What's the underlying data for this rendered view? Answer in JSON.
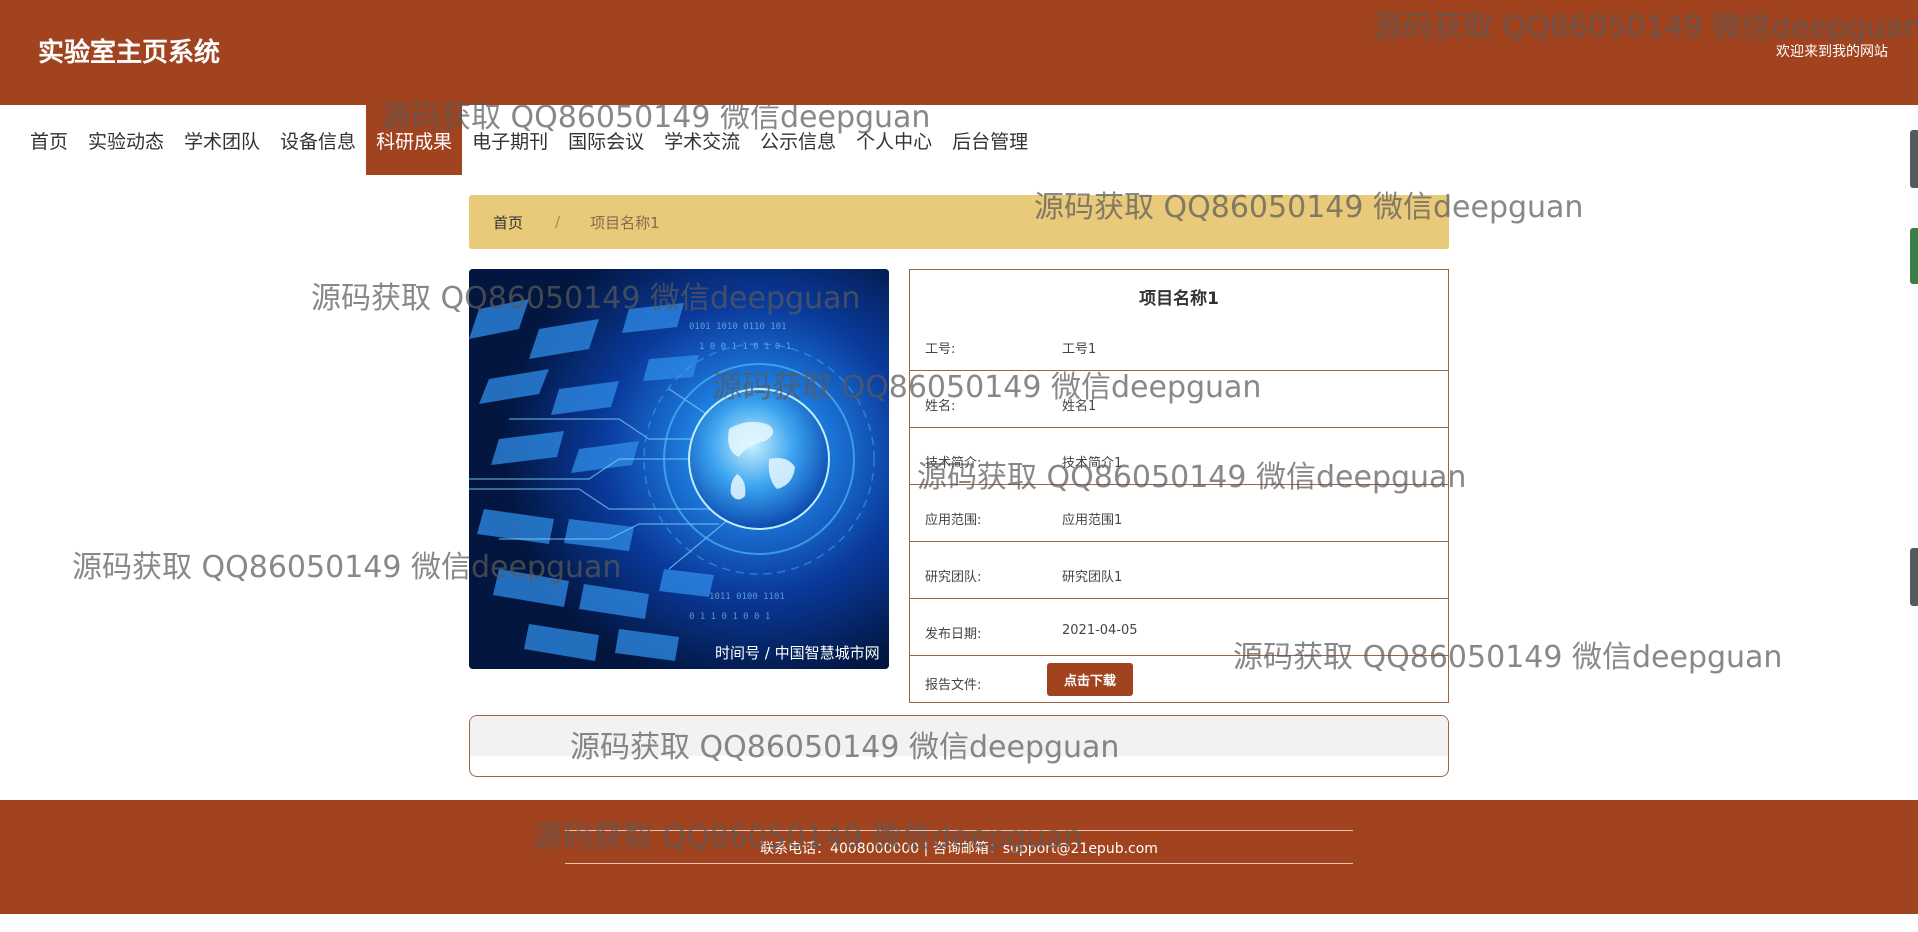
{
  "header": {
    "site_title": "实验室主页系统",
    "welcome": "欢迎来到我的网站"
  },
  "nav": {
    "items": [
      {
        "label": "首页"
      },
      {
        "label": "实验动态"
      },
      {
        "label": "学术团队"
      },
      {
        "label": "设备信息"
      },
      {
        "label": "科研成果",
        "active": true
      },
      {
        "label": "电子期刊"
      },
      {
        "label": "国际会议"
      },
      {
        "label": "学术交流"
      },
      {
        "label": "公示信息"
      },
      {
        "label": "个人中心"
      },
      {
        "label": "后台管理"
      }
    ]
  },
  "breadcrumb": {
    "home": "首页",
    "separator": "/",
    "current": "项目名称1"
  },
  "image": {
    "caption": "时间号 / 中国智慧城市网",
    "icon": "digital-globe-image"
  },
  "detail": {
    "title": "项目名称1",
    "fields": [
      {
        "label": "工号:",
        "value": "工号1"
      },
      {
        "label": "姓名:",
        "value": "姓名1"
      },
      {
        "label": "技术简介:",
        "value": "技术简介1"
      },
      {
        "label": "应用范围:",
        "value": "应用范围1"
      },
      {
        "label": "研究团队:",
        "value": "研究团队1"
      },
      {
        "label": "发布日期:",
        "value": "2021-04-05"
      }
    ],
    "report_label": "报告文件:",
    "download_label": "点击下载"
  },
  "footer": {
    "contact": "联系电话：4008000000 | 咨询邮箱：support@21epub.com"
  },
  "watermark": {
    "text": "源码获取 QQ86050149 微信deepguan"
  },
  "colors": {
    "primary": "#a0431e",
    "breadcrumb_bg": "#e9c97a",
    "border": "#9c6546"
  }
}
